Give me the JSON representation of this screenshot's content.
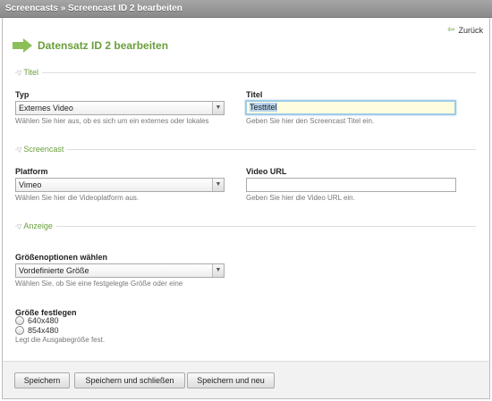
{
  "window": {
    "title": "Screencasts » Screencast ID 2 bearbeiten"
  },
  "header": {
    "back_label": "Zurück",
    "title": "Datensatz ID 2 bearbeiten"
  },
  "sections": {
    "titel": "Titel",
    "screencast": "Screencast",
    "anzeige": "Anzeige"
  },
  "fields": {
    "typ": {
      "label": "Typ",
      "value": "Externes Video",
      "hint": "Wählen Sie hier aus, ob es sich um ein externes oder lokales"
    },
    "titel": {
      "label": "Titel",
      "value": "Testtitel",
      "hint": "Geben Sie hier den Screencast Titel ein."
    },
    "platform": {
      "label": "Platform",
      "value": "Vimeo",
      "hint": "Wählen Sie hier die Videoplatform aus."
    },
    "video_url": {
      "label": "Video URL",
      "value": "",
      "hint": "Geben Sie hier die Video URL ein."
    },
    "groessenoptionen": {
      "label": "Größenoptionen wählen",
      "value": "Vordefinierte Größe",
      "hint": "Wählen Sie, ob Sie eine festgelegte Größe oder eine"
    },
    "groesse": {
      "label": "Größe festlegen",
      "options": [
        "640x480",
        "854x480"
      ],
      "hint": "Legt die Ausgabegröße fest."
    }
  },
  "footer": {
    "save": "Speichern",
    "save_close": "Speichern und schließen",
    "save_new": "Speichern und neu"
  },
  "colors": {
    "accent": "#6a9f3a",
    "titlebar": "#999999",
    "focus": "#9ecbe8"
  }
}
